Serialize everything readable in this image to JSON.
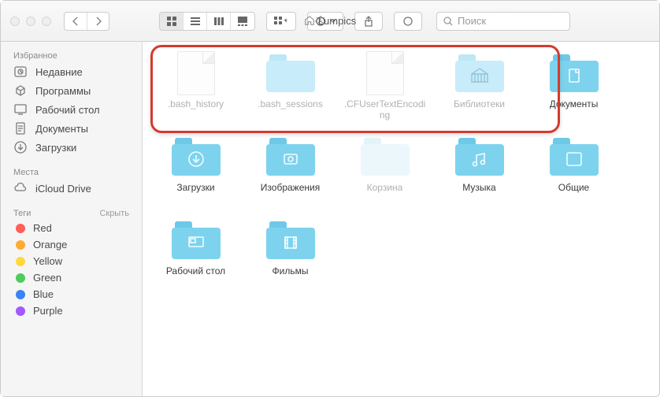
{
  "window": {
    "title": "Lumpics"
  },
  "search": {
    "placeholder": "Поиск"
  },
  "sidebar": {
    "favorites_header": "Избранное",
    "places_header": "Места",
    "tags_header": "Теги",
    "hide_label": "Скрыть",
    "fav": [
      {
        "label": "Недавние",
        "icon": "clock"
      },
      {
        "label": "Программы",
        "icon": "apps"
      },
      {
        "label": "Рабочий стол",
        "icon": "desktop"
      },
      {
        "label": "Документы",
        "icon": "docs"
      },
      {
        "label": "Загрузки",
        "icon": "downloads"
      }
    ],
    "places": [
      {
        "label": "iCloud Drive",
        "icon": "cloud"
      }
    ],
    "tags": [
      {
        "label": "Red",
        "color": "#ff5f57"
      },
      {
        "label": "Orange",
        "color": "#ffaa33"
      },
      {
        "label": "Yellow",
        "color": "#ffd93b"
      },
      {
        "label": "Green",
        "color": "#4ecc5e"
      },
      {
        "label": "Blue",
        "color": "#3b82f6"
      },
      {
        "label": "Purple",
        "color": "#a259ff"
      }
    ]
  },
  "items": [
    {
      "label": ".bash_history",
      "type": "file",
      "dim": true
    },
    {
      "label": ".bash_sessions",
      "type": "folder",
      "variant": "lightblue",
      "dim": true
    },
    {
      "label": ".CFUserTextEncoding",
      "type": "file",
      "dim": true
    },
    {
      "label": "Библиотеки",
      "type": "folder",
      "variant": "lightblue",
      "glyph": "library",
      "dim": true
    },
    {
      "label": "Документы",
      "type": "folder",
      "variant": "blue",
      "glyph": "doc"
    },
    {
      "label": "Загрузки",
      "type": "folder",
      "variant": "blue",
      "glyph": "download"
    },
    {
      "label": "Изображения",
      "type": "folder",
      "variant": "blue",
      "glyph": "image"
    },
    {
      "label": "Корзина",
      "type": "folder",
      "variant": "faint",
      "dim": true
    },
    {
      "label": "Музыка",
      "type": "folder",
      "variant": "blue",
      "glyph": "music"
    },
    {
      "label": "Общие",
      "type": "folder",
      "variant": "blue",
      "glyph": "share"
    },
    {
      "label": "Рабочий стол",
      "type": "folder",
      "variant": "blue",
      "glyph": "desktop"
    },
    {
      "label": "Фильмы",
      "type": "folder",
      "variant": "blue",
      "glyph": "film"
    }
  ]
}
